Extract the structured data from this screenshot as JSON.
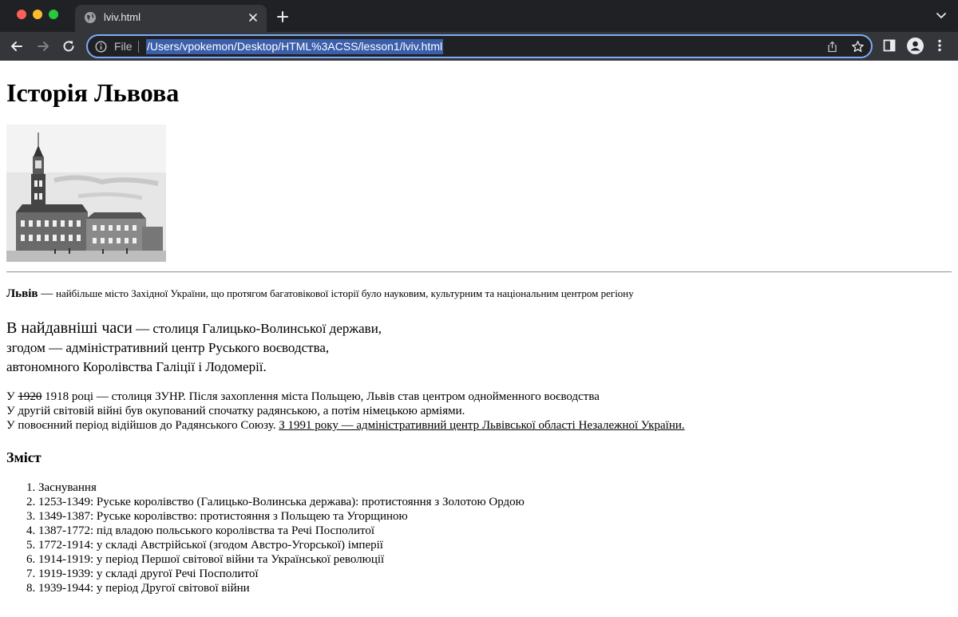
{
  "browser": {
    "tab_title": "lviv.html",
    "url_scheme": "File",
    "url": "/Users/vpokemon/Desktop/HTML%3ACSS/lesson1/lviv.html"
  },
  "page": {
    "title": "Історія Львова",
    "intro": {
      "bold": "Львів",
      "dash": " — ",
      "text": "найбільше місто Західної України, що протягом багатовікової історії було науковим, культурним та національним центром регіону"
    },
    "big_block": {
      "lead": "В найдавніші часи",
      "line1_rest": " — столиця Галицько-Волинської держави,",
      "line2": "згодом — адміністративний центр Руського воєводства,",
      "line3": "автономного Королівства Галіції і Лодомерії."
    },
    "para": {
      "line1_prefix": "У ",
      "line1_struck": "1920",
      "line1_rest": " 1918 році — столиця ЗУНР. Після захоплення міста Польщею, Львів став центром однойменного воєводства",
      "line2": "У другій світовій війні був окупований спочатку радянською, а потім німецькою арміями.",
      "line3_prefix": "У повоєнний період відійшов до Радянського Союзу. ",
      "line3_underlined": "З 1991 року — адміністративний центр Львівської області Незалежної України."
    },
    "contents_heading": "Зміст",
    "contents": [
      "Заснування",
      "1253-1349: Руське королівство (Галицько-Волинська держава): протистояння з Золотою Ордою",
      "1349-1387: Руське королівство: протистояння з Польщею та Угорщиною",
      "1387-1772: під владою польського королівства та Речі Посполитої",
      "1772-1914: у складі Австрійської (згодом Австро-Угорської) імперії",
      "1914-1919: у період Першої світової війни та Української революції",
      "1919-1939: у складі другої Речі Посполитої",
      "1939-1944: у період Другої світової війни"
    ]
  }
}
